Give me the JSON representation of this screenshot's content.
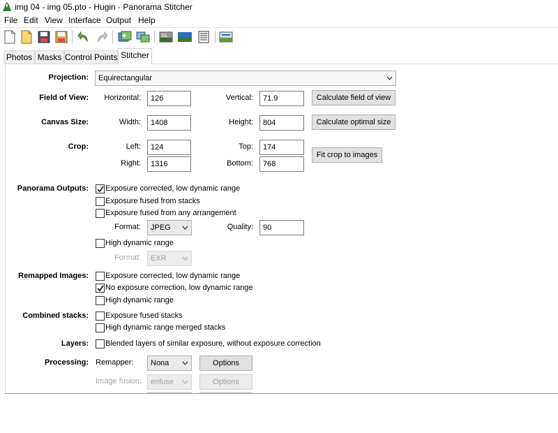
{
  "window": {
    "title": "img 04 - img 05.pto - Hugin - Panorama Stitcher"
  },
  "menu": [
    "File",
    "Edit",
    "View",
    "Interface",
    "Output",
    "Help"
  ],
  "toolbar": {
    "icons": [
      "new-project-icon",
      "open-project-icon",
      "save-project-icon",
      "save-as-icon",
      "undo-icon",
      "redo-icon",
      "add-images-icon",
      "align-icon",
      "opengl-preview-icon",
      "fast-preview-icon",
      "panorama-info-icon",
      "stitch-icon"
    ]
  },
  "tabs": [
    "Photos",
    "Masks",
    "Control Points",
    "Stitcher"
  ],
  "projection": {
    "label": "Projection:",
    "value": "Equirectangular"
  },
  "fov": {
    "label": "Field of View:",
    "horizontal_label": "Horizontal:",
    "horizontal": "126",
    "vertical_label": "Vertical:",
    "vertical": "71.9",
    "button": "Calculate field of view"
  },
  "canvas": {
    "label": "Canvas Size:",
    "width_label": "Width:",
    "width": "1408",
    "height_label": "Height:",
    "height": "804",
    "button": "Calculate optimal size"
  },
  "crop": {
    "label": "Crop:",
    "left_label": "Left:",
    "left": "124",
    "top_label": "Top:",
    "top": "174",
    "right_label": "Right:",
    "right": "1316",
    "bottom_label": "Bottom:",
    "bottom": "768",
    "button": "Fit crop to images"
  },
  "outputs": {
    "label": "Panorama Outputs:",
    "exposure_corrected_ldr": {
      "label": "Exposure corrected, low dynamic range",
      "checked": true
    },
    "fused_stacks": {
      "label": "Exposure fused from stacks",
      "checked": false
    },
    "fused_any": {
      "label": "Exposure fused from any arrangement",
      "checked": false
    },
    "format_label": "Format:",
    "format": "JPEG",
    "quality_label": "Quality:",
    "quality": "90",
    "hdr": {
      "label": "High dynamic range",
      "checked": false
    },
    "hdr_format_label": "Format:",
    "hdr_format": "EXR"
  },
  "remapped": {
    "label": "Remapped Images:",
    "exposure_corrected_ldr": {
      "label": "Exposure corrected, low dynamic range",
      "checked": false
    },
    "no_correction_ldr": {
      "label": "No exposure correction, low dynamic range",
      "checked": true
    },
    "hdr": {
      "label": "High dynamic range",
      "checked": false
    }
  },
  "stacks": {
    "label": "Combined stacks:",
    "fused": {
      "label": "Exposure fused stacks",
      "checked": false
    },
    "hdr_merged": {
      "label": "High dynamic range merged stacks",
      "checked": false
    }
  },
  "layers": {
    "label": "Layers:",
    "blended": {
      "label": "Blended layers of similar exposure, without exposure correction",
      "checked": false
    }
  },
  "processing": {
    "label": "Processing:",
    "remapper_label": "Remapper:",
    "remapper": "Nona",
    "remapper_options": "Options",
    "fusion_label": "Image fusion:",
    "fusion": "enfuse",
    "fusion_options": "Options"
  }
}
